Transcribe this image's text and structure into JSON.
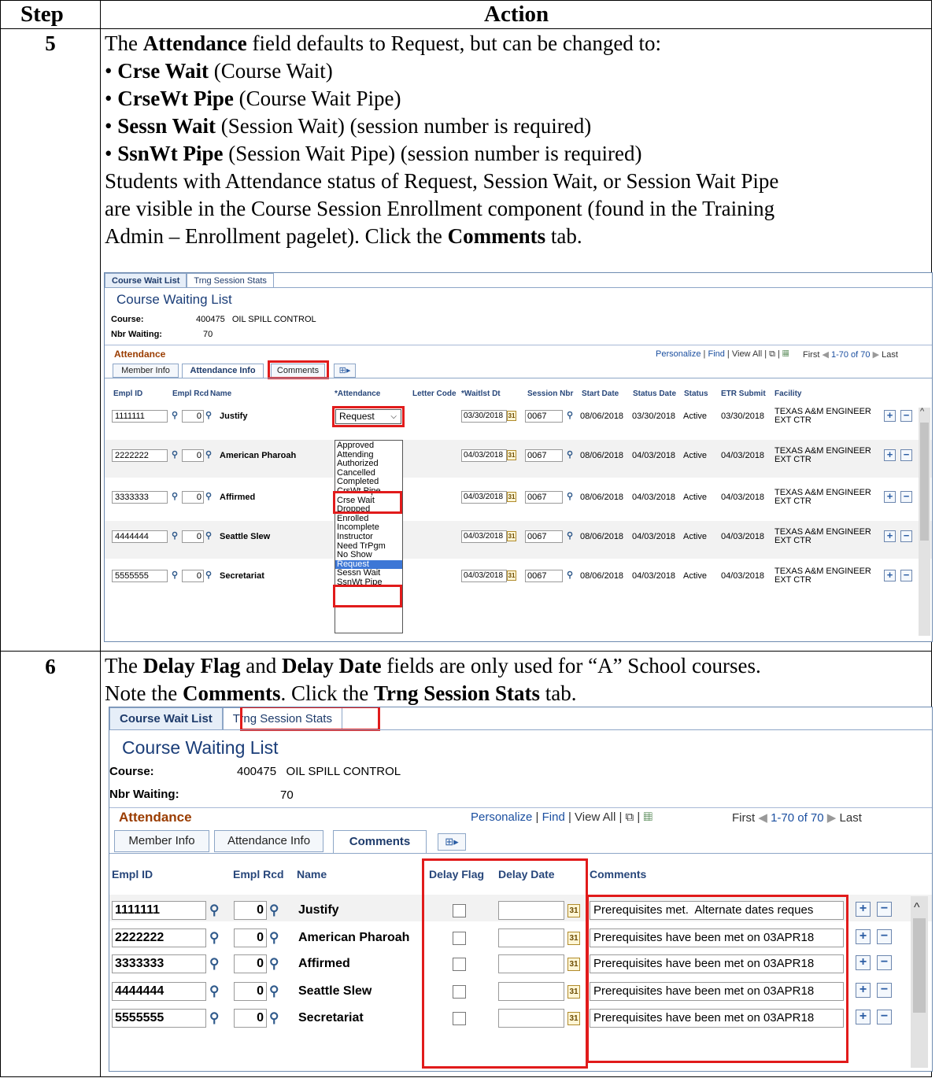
{
  "table": {
    "header_step": "Step",
    "header_action": "Action"
  },
  "step5": {
    "num": "5",
    "intro": [
      "The ",
      "Attendance",
      " field defaults to Request, but can be changed to:"
    ],
    "bullets": [
      {
        "bold": "Crse Wait",
        "rest": " (Course Wait)"
      },
      {
        "bold": "CrseWt Pipe",
        "rest": " (Course Wait Pipe)"
      },
      {
        "bold": "Sessn Wait",
        "rest": " (Session Wait) (session number is required)"
      },
      {
        "bold": "SsnWt Pipe",
        "rest": " (Session Wait Pipe) (session number is required)"
      }
    ],
    "line1": "Students with Attendance status of Request, Session Wait, or Session Wait Pipe",
    "line2": "are visible in the Course Session Enrollment component (found in the Training",
    "line3_a": "Admin – Enrollment pagelet). Click the ",
    "line3_b": "Comments",
    "line3_c": " tab."
  },
  "step6": {
    "num": "6",
    "l1_a": "The ",
    "l1_b": "Delay Flag",
    "l1_c": " and ",
    "l1_d": "Delay Date",
    "l1_e": " fields are only used for “A” School courses.",
    "l2_a": "Note the ",
    "l2_b": "Comments",
    "l2_c": ". Click the ",
    "l2_d": "Trng Session Stats",
    "l2_e": " tab."
  },
  "screen": {
    "tab_wait": "Course Wait List",
    "tab_stats": "Trng Session Stats",
    "title": "Course Waiting List",
    "course_label": "Course:",
    "course_value": "400475   OIL SPILL CONTROL",
    "nbr_label": "Nbr Waiting:",
    "nbr_value": "70",
    "grid_title": "Attendance",
    "personalize": "Personalize",
    "find": "Find",
    "view_all": "View All",
    "first": "First",
    "range": "1-70 of 70",
    "last": "Last",
    "subtab_member": "Member Info",
    "subtab_attendance": "Attendance Info",
    "subtab_comments": "Comments"
  },
  "grid1": {
    "headers": [
      "Empl ID",
      "Empl Rcd",
      "Name",
      "*Attendance",
      "Letter Code",
      "*Waitlst Dt",
      "Session Nbr",
      "Start Date",
      "Status Date",
      "Status",
      "ETR Submit",
      "Facility"
    ],
    "rows": [
      {
        "id": "1111111",
        "rcd": "0",
        "name": "Justify",
        "wdt": "03/30/2018",
        "sess": "0067",
        "start": "08/06/2018",
        "sdate": "03/30/2018",
        "status": "Active",
        "etr": "03/30/2018",
        "fac1": "TEXAS A&M ENGINEER",
        "fac2": "EXT CTR"
      },
      {
        "id": "2222222",
        "rcd": "0",
        "name": "American Pharoah",
        "wdt": "04/03/2018",
        "sess": "0067",
        "start": "08/06/2018",
        "sdate": "04/03/2018",
        "status": "Active",
        "etr": "04/03/2018",
        "fac1": "TEXAS A&M ENGINEER",
        "fac2": "EXT CTR"
      },
      {
        "id": "3333333",
        "rcd": "0",
        "name": "Affirmed",
        "wdt": "04/03/2018",
        "sess": "0067",
        "start": "08/06/2018",
        "sdate": "04/03/2018",
        "status": "Active",
        "etr": "04/03/2018",
        "fac1": "TEXAS A&M ENGINEER",
        "fac2": "EXT CTR"
      },
      {
        "id": "4444444",
        "rcd": "0",
        "name": "Seattle Slew",
        "wdt": "04/03/2018",
        "sess": "0067",
        "start": "08/06/2018",
        "sdate": "04/03/2018",
        "status": "Active",
        "etr": "04/03/2018",
        "fac1": "TEXAS A&M ENGINEER",
        "fac2": "EXT CTR"
      },
      {
        "id": "5555555",
        "rcd": "0",
        "name": "Secretariat",
        "wdt": "04/03/2018",
        "sess": "0067",
        "start": "08/06/2018",
        "sdate": "04/03/2018",
        "status": "Active",
        "etr": "04/03/2018",
        "fac1": "TEXAS A&M ENGINEER",
        "fac2": "EXT CTR"
      }
    ],
    "attendance_selected": "Request",
    "dropdown_options": [
      "Approved",
      "Attending",
      "Authorized",
      "Cancelled",
      "Completed",
      "CrsWt Pipe",
      "Crse Wait",
      "Dropped",
      "Enrolled",
      "Incomplete",
      "Instructor",
      "Need TrPgm",
      "No Show",
      "Request",
      "Sessn Wait",
      "SsnWt Pipe"
    ],
    "dropdown_highlighted": "Request"
  },
  "grid2": {
    "headers": [
      "Empl ID",
      "Empl Rcd",
      "Name",
      "Delay Flag",
      "Delay Date",
      "Comments"
    ],
    "rows": [
      {
        "id": "1111111",
        "rcd": "0",
        "name": "Justify",
        "comment": "Prerequisites met.  Alternate dates reques"
      },
      {
        "id": "2222222",
        "rcd": "0",
        "name": "American Pharoah",
        "comment": "Prerequisites have been met on 03APR18"
      },
      {
        "id": "3333333",
        "rcd": "0",
        "name": "Affirmed",
        "comment": "Prerequisites have been met on 03APR18"
      },
      {
        "id": "4444444",
        "rcd": "0",
        "name": "Seattle Slew",
        "comment": "Prerequisites have been met on 03APR18"
      },
      {
        "id": "5555555",
        "rcd": "0",
        "name": "Secretariat",
        "comment": "Prerequisites have been met on 03APR18"
      }
    ]
  },
  "colors": {
    "highlight": "#e11b1b",
    "title": "#1a3d78",
    "grid_title": "#9a3c00"
  }
}
